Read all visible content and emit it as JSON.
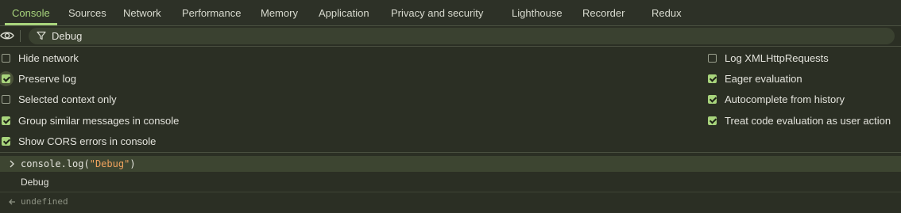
{
  "tabs": [
    {
      "label": "Console",
      "active": true
    },
    {
      "label": "Sources"
    },
    {
      "label": "Network"
    },
    {
      "label": "Performance"
    },
    {
      "label": "Memory"
    },
    {
      "label": "Application"
    },
    {
      "label": "Privacy and security"
    },
    {
      "label": "Lighthouse"
    },
    {
      "label": "Recorder"
    },
    {
      "label": "Redux"
    }
  ],
  "filter": {
    "value": "Debug",
    "icons": [
      "eye-icon",
      "filter-icon"
    ]
  },
  "settings": {
    "left": [
      {
        "label": "Hide network",
        "checked": false
      },
      {
        "label": "Preserve log",
        "checked": true
      },
      {
        "label": "Selected context only",
        "checked": false
      },
      {
        "label": "Group similar messages in console",
        "checked": true
      },
      {
        "label": "Show CORS errors in console",
        "checked": true
      }
    ],
    "right": [
      {
        "label": "Log XMLHttpRequests",
        "checked": false
      },
      {
        "label": "Eager evaluation",
        "checked": true
      },
      {
        "label": "Autocomplete from history",
        "checked": true
      },
      {
        "label": "Treat code evaluation as user action",
        "checked": true
      }
    ]
  },
  "console": {
    "input": {
      "object": "console",
      "dot": ".",
      "method": "log",
      "open": "(",
      "string": "\"Debug\"",
      "close": ")"
    },
    "output": "Debug",
    "result": "undefined"
  },
  "colors": {
    "accent": "#a8d47c",
    "background": "#2b2f24",
    "string": "#f0a35e"
  }
}
